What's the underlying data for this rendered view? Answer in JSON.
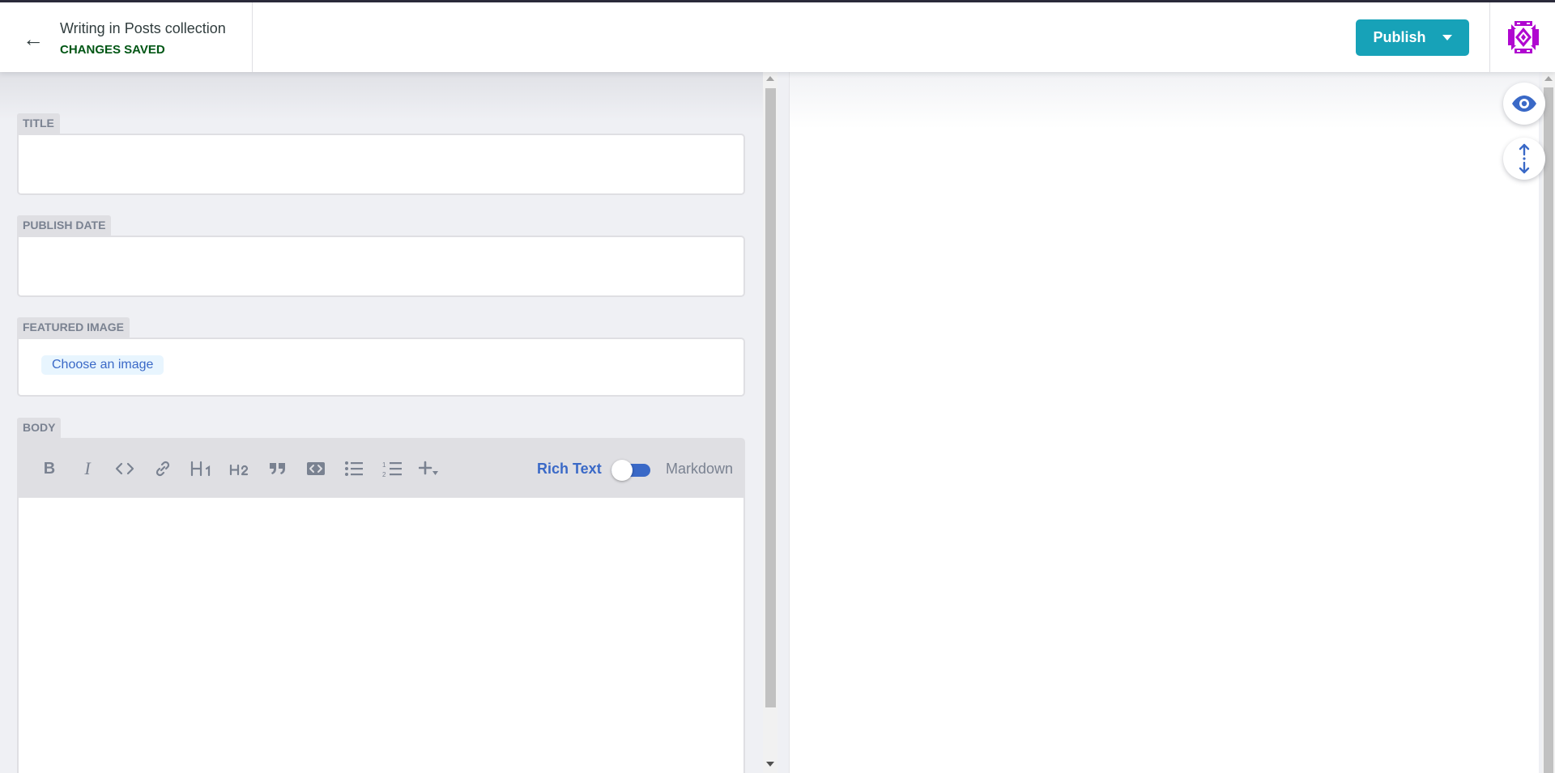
{
  "header": {
    "back_glyph": "←",
    "collection_title": "Writing in Posts collection",
    "save_status": "CHANGES SAVED",
    "publish_label": "Publish",
    "avatar_icon": "user-avatar-icon"
  },
  "fields": {
    "title": {
      "label": "TITLE",
      "value": ""
    },
    "publish_date": {
      "label": "PUBLISH DATE",
      "value": ""
    },
    "featured_image": {
      "label": "FEATURED IMAGE",
      "button_label": "Choose an image"
    },
    "body": {
      "label": "BODY",
      "value": ""
    }
  },
  "toolbar": {
    "tools": [
      "bold-icon",
      "italic-icon",
      "code-icon",
      "link-icon",
      "heading-one-icon",
      "heading-two-icon",
      "quote-icon",
      "code-block-icon",
      "bulleted-list-icon",
      "numbered-list-icon",
      "add-component-icon"
    ],
    "mode_rich": "Rich Text",
    "mode_markdown": "Markdown",
    "mode_selected": "Rich Text"
  },
  "preview": {
    "buttons": [
      "eye-icon",
      "sync-scroll-icon"
    ]
  },
  "colors": {
    "accent": "#3a69c7",
    "publish": "#17a2b8",
    "saved": "#005614",
    "label_bg": "#dfdfe3",
    "avatar": "#b007d0"
  }
}
